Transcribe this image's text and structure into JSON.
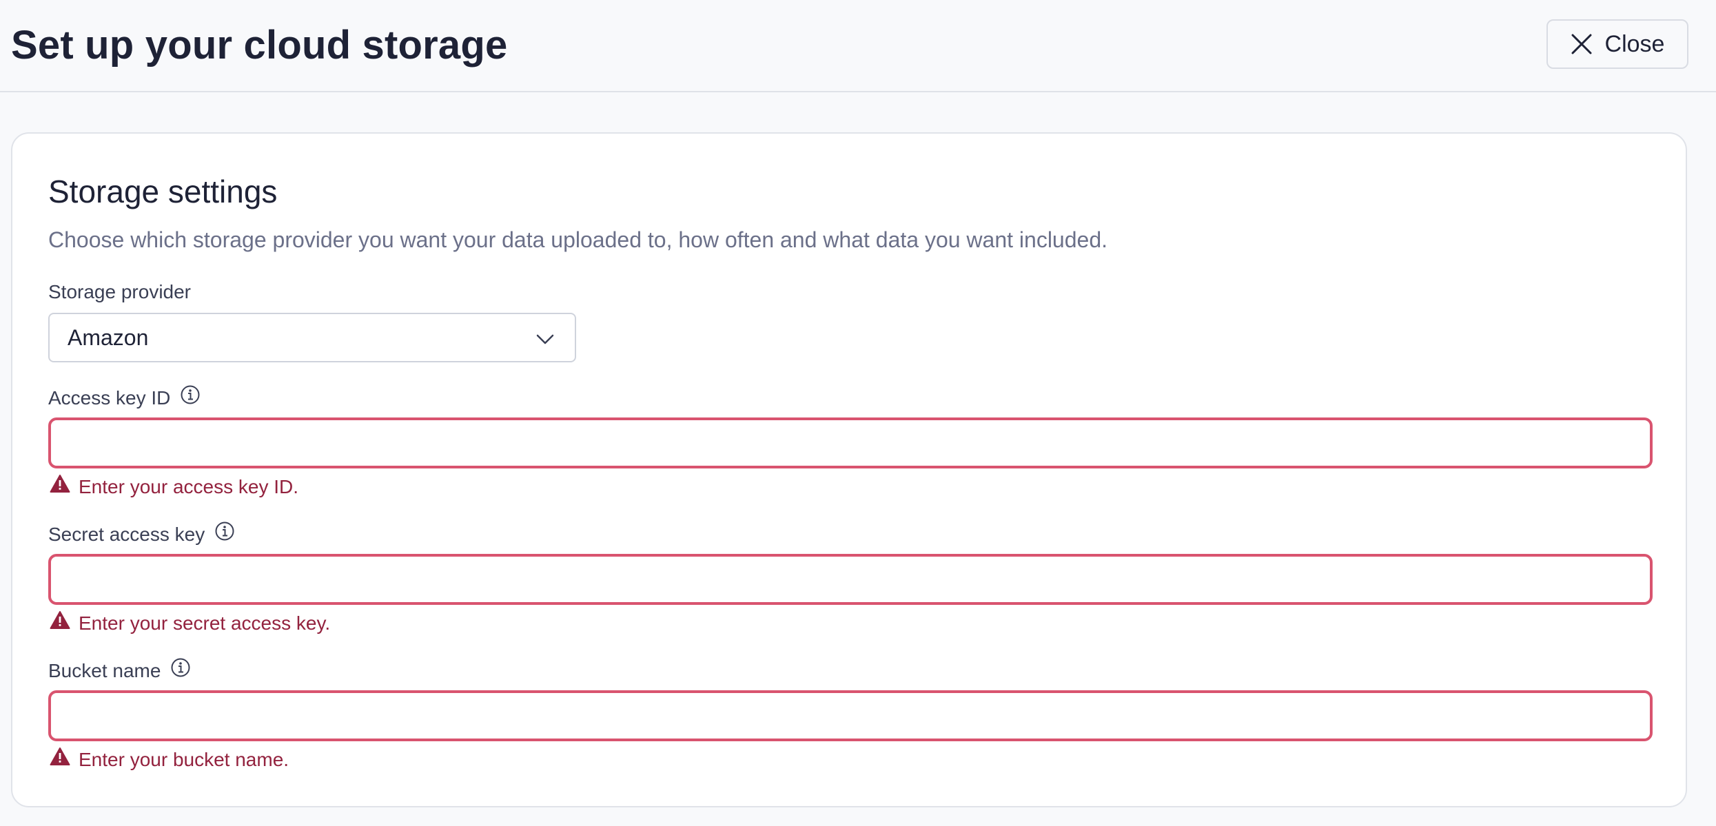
{
  "header": {
    "title": "Set up your cloud storage",
    "close_label": "Close"
  },
  "storage": {
    "title": "Storage settings",
    "description": "Choose which storage provider you want your data uploaded to, how often and what data you want included.",
    "provider": {
      "label": "Storage provider",
      "selected": "Amazon"
    },
    "access_key_id": {
      "label": "Access key ID",
      "value": "",
      "error": "Enter your access key ID."
    },
    "secret_access_key": {
      "label": "Secret access key",
      "value": "",
      "error": "Enter your secret access key."
    },
    "bucket_name": {
      "label": "Bucket name",
      "value": "",
      "error": "Enter your bucket name."
    }
  },
  "colors": {
    "error_border": "#d9546f",
    "error_text": "#93223e",
    "muted_text": "#6b7089",
    "title_text": "#1e2236"
  },
  "icons": {
    "close": "x-icon",
    "dropdown": "chevron-down-icon",
    "info": "info-icon",
    "error": "warning-triangle-icon"
  }
}
